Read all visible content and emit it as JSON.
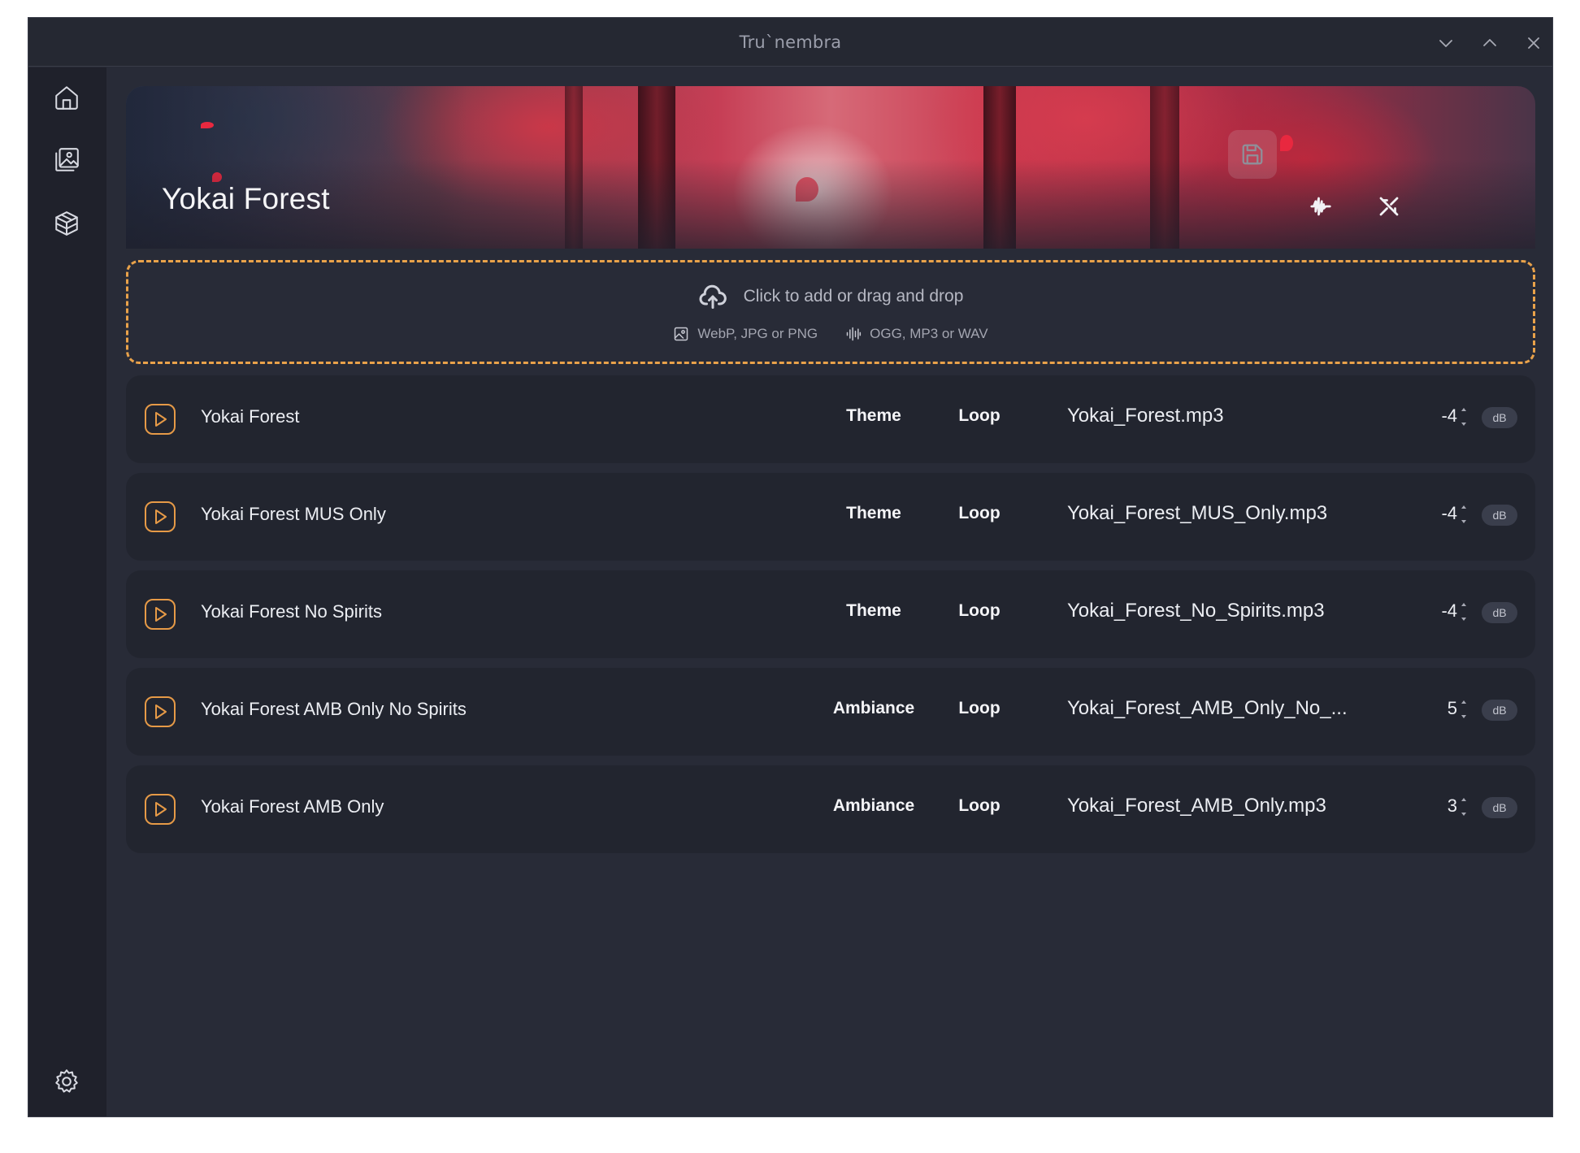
{
  "window": {
    "title": "Tru`nembra"
  },
  "sidebar": {
    "items": [
      {
        "name": "home",
        "icon": "home-icon"
      },
      {
        "name": "gallery",
        "icon": "image-gallery-icon"
      },
      {
        "name": "packages",
        "icon": "package-icon"
      }
    ],
    "footer_icon": "gear-icon"
  },
  "scene": {
    "title": "Yokai Forest",
    "actions": [
      "save-icon",
      "audio-wave-icon",
      "mute-icon"
    ]
  },
  "dropzone": {
    "main_text": "Click to add or drag and drop",
    "image_formats": "WebP, JPG or PNG",
    "audio_formats": "OGG, MP3 or WAV"
  },
  "tracks": [
    {
      "name": "Yokai Forest",
      "category": "Theme",
      "mode": "Loop",
      "file": "Yokai_Forest.mp3",
      "volume": "-4",
      "unit": "dB"
    },
    {
      "name": "Yokai Forest MUS Only",
      "category": "Theme",
      "mode": "Loop",
      "file": "Yokai_Forest_MUS_Only.mp3",
      "volume": "-4",
      "unit": "dB"
    },
    {
      "name": "Yokai Forest No Spirits",
      "category": "Theme",
      "mode": "Loop",
      "file": "Yokai_Forest_No_Spirits.mp3",
      "volume": "-4",
      "unit": "dB"
    },
    {
      "name": "Yokai Forest AMB Only No Spirits",
      "category": "Ambiance",
      "mode": "Loop",
      "file": "Yokai_Forest_AMB_Only_No_...",
      "volume": "5",
      "unit": "dB"
    },
    {
      "name": "Yokai Forest AMB Only",
      "category": "Ambiance",
      "mode": "Loop",
      "file": "Yokai_Forest_AMB_Only.mp3",
      "volume": "3",
      "unit": "dB"
    }
  ],
  "colors": {
    "accent": "#e69a47",
    "background": "#282b37",
    "sidebar": "#1f212b",
    "row": "#22252f"
  }
}
